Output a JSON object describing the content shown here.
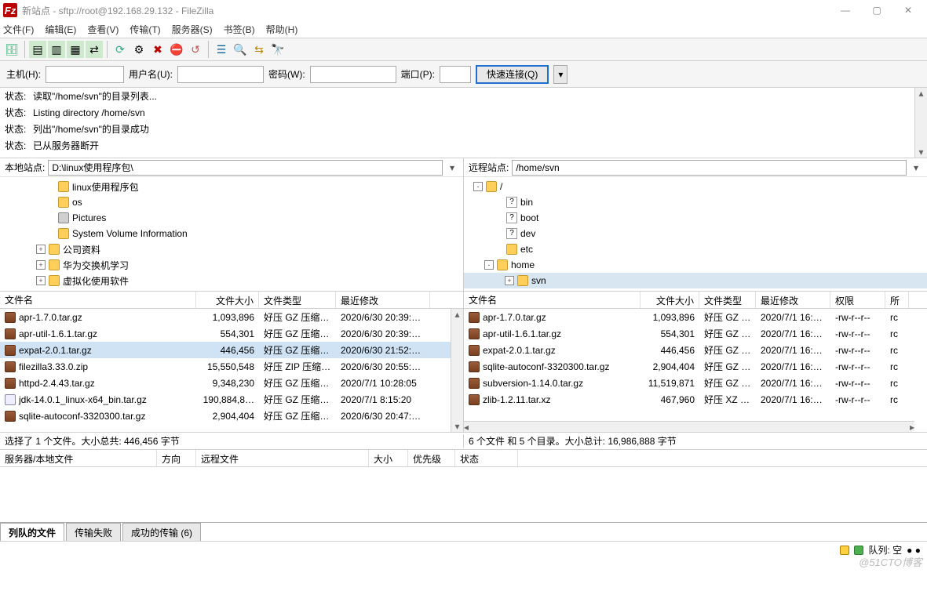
{
  "titlebar": {
    "title": "新站点 - sftp://root@192.168.29.132 - FileZilla"
  },
  "menubar": [
    "文件(F)",
    "编辑(E)",
    "查看(V)",
    "传输(T)",
    "服务器(S)",
    "书签(B)",
    "帮助(H)"
  ],
  "quickconnect": {
    "host_label": "主机(H):",
    "user_label": "用户名(U):",
    "pass_label": "密码(W):",
    "port_label": "端口(P):",
    "button": "快速连接(Q)"
  },
  "log": [
    {
      "label": "状态:",
      "msg": "读取\"/home/svn\"的目录列表..."
    },
    {
      "label": "状态:",
      "msg": "Listing directory /home/svn"
    },
    {
      "label": "状态:",
      "msg": "列出\"/home/svn\"的目录成功"
    },
    {
      "label": "状态:",
      "msg": "已从服务器断开"
    }
  ],
  "local": {
    "path_label": "本地站点:",
    "path_value": "D:\\linux使用程序包\\",
    "tree": [
      {
        "indent": 50,
        "icon": "folder",
        "name": "linux使用程序包",
        "sel": false,
        "expander": ""
      },
      {
        "indent": 50,
        "icon": "folder",
        "name": "os",
        "sel": false,
        "expander": ""
      },
      {
        "indent": 50,
        "icon": "disk",
        "name": "Pictures",
        "sel": false,
        "expander": ""
      },
      {
        "indent": 50,
        "icon": "folder",
        "name": "System Volume Information",
        "sel": false,
        "expander": ""
      },
      {
        "indent": 38,
        "icon": "folder",
        "name": "公司资料",
        "sel": false,
        "expander": "+"
      },
      {
        "indent": 38,
        "icon": "folder",
        "name": "华为交换机学习",
        "sel": false,
        "expander": "+"
      },
      {
        "indent": 38,
        "icon": "folder",
        "name": "虚拟化使用软件",
        "sel": false,
        "expander": "+"
      }
    ]
  },
  "remote": {
    "path_label": "远程站点:",
    "path_value": "/home/svn",
    "tree": [
      {
        "indent": 4,
        "icon": "folder",
        "name": "/",
        "sel": false,
        "expander": "-"
      },
      {
        "indent": 30,
        "icon": "unknown",
        "name": "bin",
        "sel": false,
        "expander": ""
      },
      {
        "indent": 30,
        "icon": "unknown",
        "name": "boot",
        "sel": false,
        "expander": ""
      },
      {
        "indent": 30,
        "icon": "unknown",
        "name": "dev",
        "sel": false,
        "expander": ""
      },
      {
        "indent": 30,
        "icon": "folder",
        "name": "etc",
        "sel": false,
        "expander": ""
      },
      {
        "indent": 18,
        "icon": "folder",
        "name": "home",
        "sel": false,
        "expander": "-"
      },
      {
        "indent": 44,
        "icon": "folder",
        "name": "svn",
        "sel": true,
        "expander": "+"
      }
    ]
  },
  "local_files": {
    "headers": [
      "文件名",
      "文件大小",
      "文件类型",
      "最近修改"
    ],
    "rows": [
      {
        "name": "apr-1.7.0.tar.gz",
        "size": "1,093,896",
        "type": "好压 GZ 压缩…",
        "mod": "2020/6/30 20:39:…",
        "sel": false,
        "ico": "arc"
      },
      {
        "name": "apr-util-1.6.1.tar.gz",
        "size": "554,301",
        "type": "好压 GZ 压缩…",
        "mod": "2020/6/30 20:39:…",
        "sel": false,
        "ico": "arc"
      },
      {
        "name": "expat-2.0.1.tar.gz",
        "size": "446,456",
        "type": "好压 GZ 压缩…",
        "mod": "2020/6/30 21:52:…",
        "sel": true,
        "ico": "arc"
      },
      {
        "name": "filezilla3.33.0.zip",
        "size": "15,550,548",
        "type": "好压 ZIP 压缩…",
        "mod": "2020/6/30 20:55:…",
        "sel": false,
        "ico": "arc"
      },
      {
        "name": "httpd-2.4.43.tar.gz",
        "size": "9,348,230",
        "type": "好压 GZ 压缩…",
        "mod": "2020/7/1 10:28:05",
        "sel": false,
        "ico": "arc"
      },
      {
        "name": "jdk-14.0.1_linux-x64_bin.tar.gz",
        "size": "190,884,8…",
        "type": "好压 GZ 压缩…",
        "mod": "2020/7/1 8:15:20",
        "sel": false,
        "ico": "gen"
      },
      {
        "name": "sqlite-autoconf-3320300.tar.gz",
        "size": "2,904,404",
        "type": "好压 GZ 压缩…",
        "mod": "2020/6/30 20:47:…",
        "sel": false,
        "ico": "arc"
      }
    ]
  },
  "remote_files": {
    "headers": [
      "文件名",
      "文件大小",
      "文件类型",
      "最近修改",
      "权限",
      "所"
    ],
    "rows": [
      {
        "name": "apr-1.7.0.tar.gz",
        "size": "1,093,896",
        "type": "好压 GZ …",
        "mod": "2020/7/1 16:…",
        "perm": "-rw-r--r--",
        "own": "rc"
      },
      {
        "name": "apr-util-1.6.1.tar.gz",
        "size": "554,301",
        "type": "好压 GZ …",
        "mod": "2020/7/1 16:…",
        "perm": "-rw-r--r--",
        "own": "rc"
      },
      {
        "name": "expat-2.0.1.tar.gz",
        "size": "446,456",
        "type": "好压 GZ …",
        "mod": "2020/7/1 16:…",
        "perm": "-rw-r--r--",
        "own": "rc"
      },
      {
        "name": "sqlite-autoconf-3320300.tar.gz",
        "size": "2,904,404",
        "type": "好压 GZ …",
        "mod": "2020/7/1 16:…",
        "perm": "-rw-r--r--",
        "own": "rc"
      },
      {
        "name": "subversion-1.14.0.tar.gz",
        "size": "11,519,871",
        "type": "好压 GZ …",
        "mod": "2020/7/1 16:…",
        "perm": "-rw-r--r--",
        "own": "rc"
      },
      {
        "name": "zlib-1.2.11.tar.xz",
        "size": "467,960",
        "type": "好压 XZ …",
        "mod": "2020/7/1 16:…",
        "perm": "-rw-r--r--",
        "own": "rc"
      }
    ]
  },
  "status": {
    "local": "选择了 1 个文件。大小总共: 446,456 字节",
    "remote": "6 个文件 和 5 个目录。大小总计: 16,986,888 字节"
  },
  "queue_headers": [
    "服务器/本地文件",
    "方向",
    "远程文件",
    "大小",
    "优先级",
    "状态"
  ],
  "tabs": {
    "queued": "列队的文件",
    "failed": "传输失败",
    "success": "成功的传输 (6)"
  },
  "statusbar": {
    "queue": "队列: 空"
  },
  "watermark": "@51CTO博客"
}
